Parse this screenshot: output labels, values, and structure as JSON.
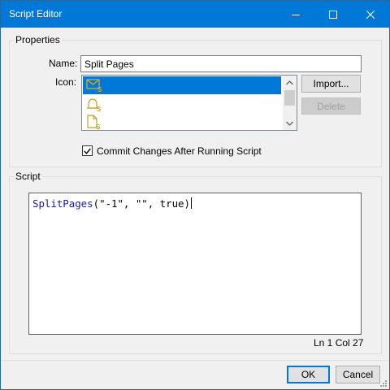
{
  "window": {
    "title": "Script Editor"
  },
  "properties": {
    "group_label": "Properties",
    "name_label": "Name:",
    "name_value": "Split Pages",
    "icon_label": "Icon:",
    "icons": [
      {
        "icon": "envelope-s-icon",
        "selected": true
      },
      {
        "icon": "bell-s-icon",
        "selected": false
      },
      {
        "icon": "page-s-icon",
        "selected": false
      }
    ],
    "import_label": "Import...",
    "delete_label": "Delete",
    "commit_label": "Commit Changes After Running Script",
    "commit_checked": true
  },
  "script": {
    "group_label": "Script",
    "code_fn": "SplitPages",
    "code_args": "(\"-1\", \"\", true)",
    "position": "Ln 1 Col 27"
  },
  "footer": {
    "ok_label": "OK",
    "cancel_label": "Cancel"
  },
  "colors": {
    "titlebar": "#0078d7",
    "selection": "#0078d7",
    "icon_gold": "#c8a020",
    "code_function": "#1a1aa6"
  }
}
